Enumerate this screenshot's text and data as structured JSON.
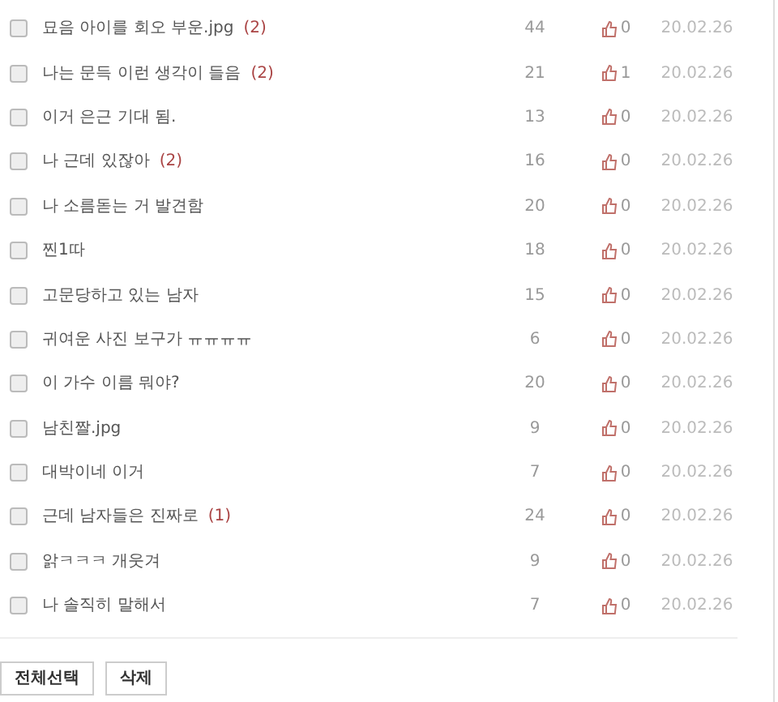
{
  "posts": [
    {
      "title": "묘음 아이를 회오 부운.jpg",
      "comments": "(2)",
      "views": "44",
      "likes": "0",
      "date": "20.02.26",
      "checked": false
    },
    {
      "title": "나는 문득 이런 생각이 들음",
      "comments": "(2)",
      "views": "21",
      "likes": "1",
      "date": "20.02.26",
      "checked": false
    },
    {
      "title": "이거 은근 기대 됨.",
      "views": "13",
      "likes": "0",
      "date": "20.02.26",
      "checked": false
    },
    {
      "title": "나 근데 있잖아",
      "comments": "(2)",
      "views": "16",
      "likes": "0",
      "date": "20.02.26",
      "checked": false
    },
    {
      "title": "나 소름돋는 거 발견함",
      "views": "20",
      "likes": "0",
      "date": "20.02.26",
      "checked": false
    },
    {
      "title": "찐1따",
      "views": "18",
      "likes": "0",
      "date": "20.02.26",
      "checked": false
    },
    {
      "title": "고문당하고 있는 남자",
      "views": "15",
      "likes": "0",
      "date": "20.02.26",
      "checked": false
    },
    {
      "title": "귀여운 사진 보구가 ㅠㅠㅠㅠ",
      "views": "6",
      "likes": "0",
      "date": "20.02.26",
      "checked": false
    },
    {
      "title": "이 가수 이름 뭐야?",
      "views": "20",
      "likes": "0",
      "date": "20.02.26",
      "checked": false
    },
    {
      "title": "남친짤.jpg",
      "views": "9",
      "likes": "0",
      "date": "20.02.26",
      "checked": false
    },
    {
      "title": "대박이네 이거",
      "views": "7",
      "likes": "0",
      "date": "20.02.26",
      "checked": false
    },
    {
      "title": "근데 남자들은 진짜로",
      "comments": "(1)",
      "views": "24",
      "likes": "0",
      "date": "20.02.26",
      "checked": false
    },
    {
      "title": "앍ㅋㅋㅋ 개웃겨",
      "views": "9",
      "likes": "0",
      "date": "20.02.26",
      "checked": false
    },
    {
      "title": "나 솔직히 말해서",
      "views": "7",
      "likes": "0",
      "date": "20.02.26",
      "checked": false
    }
  ],
  "buttons": [
    "전체선택",
    "삭제"
  ]
}
